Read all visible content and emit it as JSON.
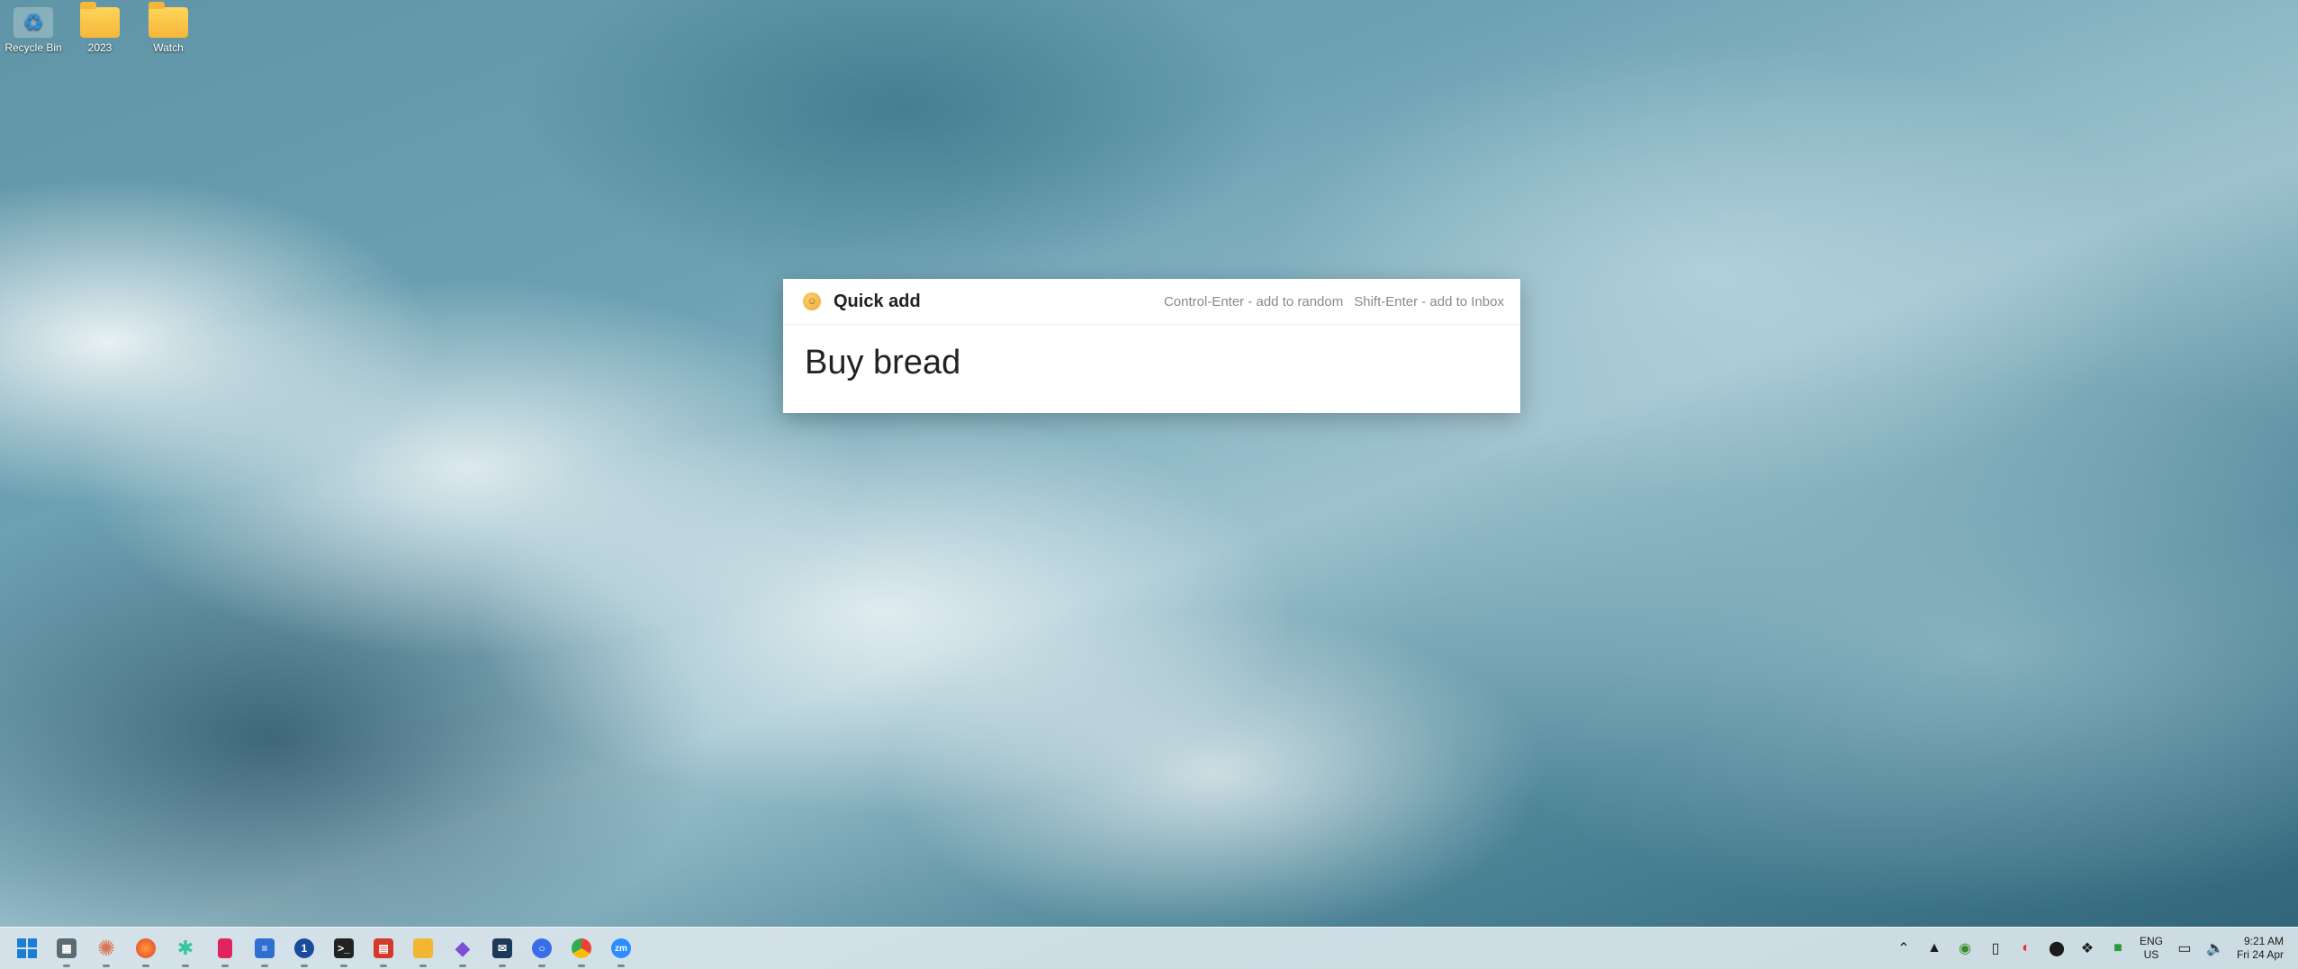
{
  "desktop": {
    "icons": [
      {
        "label": "Recycle Bin",
        "icon": "recycle-bin-icon"
      },
      {
        "label": "2023",
        "icon": "folder-shortcut-icon"
      },
      {
        "label": "Watch",
        "icon": "folder-icon"
      }
    ]
  },
  "quick_add": {
    "title": "Quick add",
    "hint_ctrl": "Control-Enter - add to random",
    "hint_shift": "Shift-Enter - add to Inbox",
    "input_value": "Buy bread"
  },
  "taskbar": {
    "apps": [
      {
        "name": "start-icon"
      },
      {
        "name": "calculator-icon"
      },
      {
        "name": "claude-icon"
      },
      {
        "name": "firefox-icon"
      },
      {
        "name": "slack-icon"
      },
      {
        "name": "bookmark-app-icon"
      },
      {
        "name": "notepad-icon"
      },
      {
        "name": "1password-icon"
      },
      {
        "name": "terminal-icon"
      },
      {
        "name": "calendar-icon"
      },
      {
        "name": "file-explorer-icon"
      },
      {
        "name": "obsidian-icon"
      },
      {
        "name": "mail-icon"
      },
      {
        "name": "signal-icon"
      },
      {
        "name": "chrome-icon"
      },
      {
        "name": "zoom-icon"
      }
    ],
    "tray": {
      "language": "ENG",
      "region": "US",
      "time": "9:21 AM",
      "date": "Fri 24 Apr"
    }
  }
}
